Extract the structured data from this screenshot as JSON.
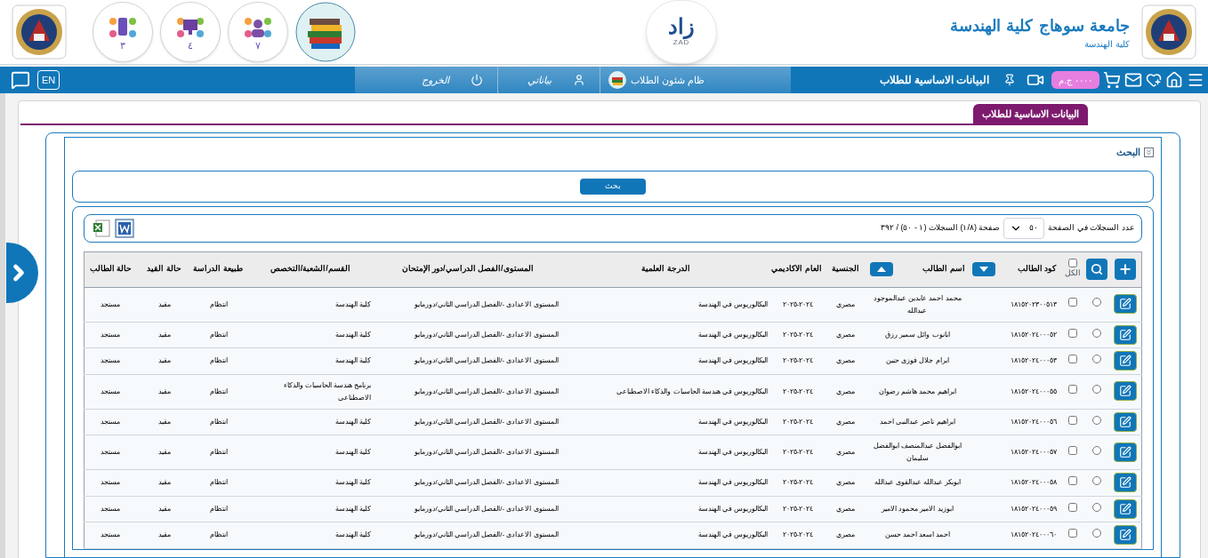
{
  "header": {
    "university": "جامعة سوهاج كلية الهندسة",
    "faculty": "كلية الهندسة",
    "logo_text": "زاد",
    "logo_caption": "ZAD",
    "app_circles": [
      {
        "count": "٧",
        "kind": "people"
      },
      {
        "count": "٤",
        "kind": "screen"
      },
      {
        "count": "٣",
        "kind": "mobile"
      }
    ]
  },
  "navbar": {
    "title": "البيانات الاساسية للطلاب",
    "balance": "٠٠٠٠ ج.م",
    "system": "ظام شئون الطلاب",
    "profile": "بياناتي",
    "logout": "الخروج",
    "language": "EN"
  },
  "tabs": [
    {
      "label": "البيانات الاساسية للطلاب",
      "selected": true
    }
  ],
  "search": {
    "title": "البحث",
    "expanded": true,
    "button": "بحث"
  },
  "pager": {
    "label": "عدد السجلات في الصفحة",
    "page_size": "٥٠",
    "summary": "صفحة (١/٨) السجلات (١ - ٥٠) / ٣٩٢"
  },
  "table": {
    "all_label": "الكل",
    "all_checked": false,
    "columns": [
      "كود الطالب",
      "اسم الطالب",
      "الجنسية",
      "العام الاكاديمي",
      "الدرجة العلمية",
      "المستوى/الفصل الدراسي/دور الإمتحان",
      "القسم/الشعبة/التخصص",
      "طبيعة الدراسة",
      "حالة القيد",
      "حالة الطالب"
    ],
    "rows": [
      {
        "selected": false,
        "checked": false,
        "cells": [
          "١٨١٥٢٠٢٣٠٠٥١٣",
          "محمد احمد عابدين عبدالموجود عبدالله",
          "مصري",
          "٢٠٢٤-٢٠٢٥",
          "البكالوريوس في الهندسة",
          "المستوى الاعدادى -/الفصل الدراسي الثاني/دورمايو",
          "كلية الهندسة",
          "انتظام",
          "مقيد",
          "مستجد"
        ]
      },
      {
        "selected": false,
        "checked": false,
        "cells": [
          "١٨١٥٢٠٢٤٠٠٠٥٢",
          "ابانوب وائل سمير رزق",
          "مصري",
          "٢٠٢٤-٢٠٢٥",
          "البكالوريوس في الهندسة",
          "المستوى الاعدادى -/الفصل الدراسي الثاني/دورمايو",
          "كلية الهندسة",
          "انتظام",
          "مقيد",
          "مستجد"
        ]
      },
      {
        "selected": false,
        "checked": false,
        "cells": [
          "١٨١٥٢٠٢٤٠٠٠٥٣",
          "ابرام جلال فوزى حنين",
          "مصري",
          "٢٠٢٤-٢٠٢٥",
          "البكالوريوس في الهندسة",
          "المستوى الاعدادى -/الفصل الدراسي الثاني/دورمايو",
          "كلية الهندسة",
          "انتظام",
          "مقيد",
          "مستجد"
        ]
      },
      {
        "selected": false,
        "checked": false,
        "cells": [
          "١٨١٥٢٠٢٤٠٠٠٥٥",
          "ابراهيم محمد هاشم رضوان",
          "مصري",
          "٢٠٢٤-٢٠٢٥",
          "البكالوريوس في هندسة الحاسبات والذكاء الاصطناعى",
          "المستوى الاعدادى -/الفصل الدراسي الثاني/دورمايو",
          "برنامج هندسة الحاسبات والذكاء الاصطناعى",
          "انتظام",
          "مقيد",
          "مستجد"
        ]
      },
      {
        "selected": false,
        "checked": false,
        "cells": [
          "١٨١٥٢٠٢٤٠٠٠٥٦",
          "ابراهيم ناصر عبدالنبى احمد",
          "مصري",
          "٢٠٢٤-٢٠٢٥",
          "البكالوريوس في الهندسة",
          "المستوى الاعدادى -/الفصل الدراسي الثاني/دورمايو",
          "كلية الهندسة",
          "انتظام",
          "مقيد",
          "مستجد"
        ]
      },
      {
        "selected": false,
        "checked": false,
        "cells": [
          "١٨١٥٢٠٢٤٠٠٠٥٧",
          "ابوالفضل عبدالمنصف ابوالفضل سليمان",
          "مصري",
          "٢٠٢٤-٢٠٢٥",
          "البكالوريوس في الهندسة",
          "المستوى الاعدادى -/الفصل الدراسي الثاني/دورمايو",
          "كلية الهندسة",
          "انتظام",
          "مقيد",
          "مستجد"
        ]
      },
      {
        "selected": false,
        "checked": false,
        "cells": [
          "١٨١٥٢٠٢٤٠٠٠٥٨",
          "ابوبكر عبدالله عبدالقوى عبدالله",
          "مصري",
          "٢٠٢٤-٢٠٢٥",
          "البكالوريوس في الهندسة",
          "المستوى الاعدادى -/الفصل الدراسي الثاني/دورمايو",
          "كلية الهندسة",
          "انتظام",
          "مقيد",
          "مستجد"
        ]
      },
      {
        "selected": false,
        "checked": false,
        "cells": [
          "١٨١٥٢٠٢٤٠٠٠٥٩",
          "ابوزيد الامير محمود الامير",
          "مصري",
          "٢٠٢٤-٢٠٢٥",
          "البكالوريوس في الهندسة",
          "المستوى الاعدادى -/الفصل الدراسي الثاني/دورمايو",
          "كلية الهندسة",
          "انتظام",
          "مقيد",
          "مستجد"
        ]
      },
      {
        "selected": false,
        "checked": false,
        "cells": [
          "١٨١٥٢٠٢٤٠٠٠٦٠",
          "احمد اسعد احمد حسن",
          "مصري",
          "٢٠٢٤-٢٠٢٥",
          "البكالوريوس في الهندسة",
          "المستوى الاعدادى -/الفصل الدراسي الثاني/دورمايو",
          "كلية الهندسة",
          "انتظام",
          "مقيد",
          "مستجد"
        ]
      }
    ]
  }
}
